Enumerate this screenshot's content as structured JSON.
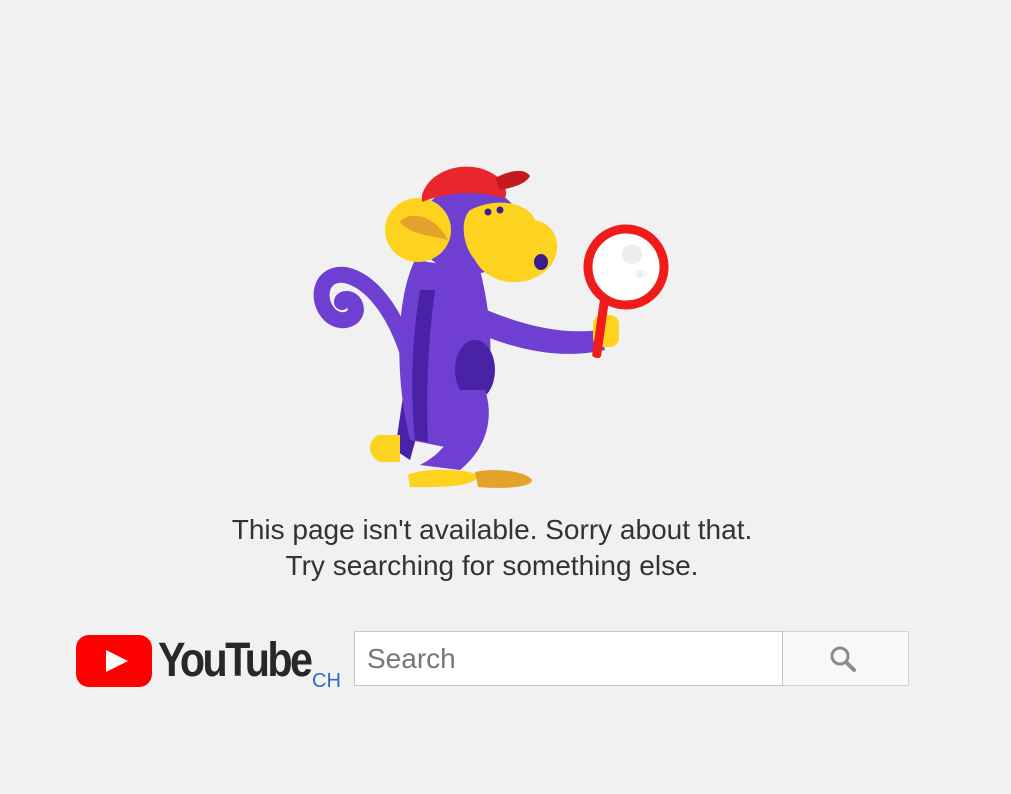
{
  "error": {
    "line1": "This page isn't available. Sorry about that.",
    "line2": "Try searching for something else."
  },
  "logo": {
    "wordmark": "YouTube",
    "country": "CH"
  },
  "search": {
    "placeholder": "Search",
    "value": ""
  },
  "colors": {
    "background": "#f1f1f1",
    "youtube_red": "#ff0000",
    "monkey_purple": "#6e3fd1",
    "monkey_yellow": "#fdd31f",
    "cap_red": "#e8262b",
    "country_link": "#2b6fc2"
  },
  "icons": {
    "illustration": "monkey-with-magnifier-illustration",
    "logo": "youtube-play-icon",
    "search_button": "search-icon"
  }
}
